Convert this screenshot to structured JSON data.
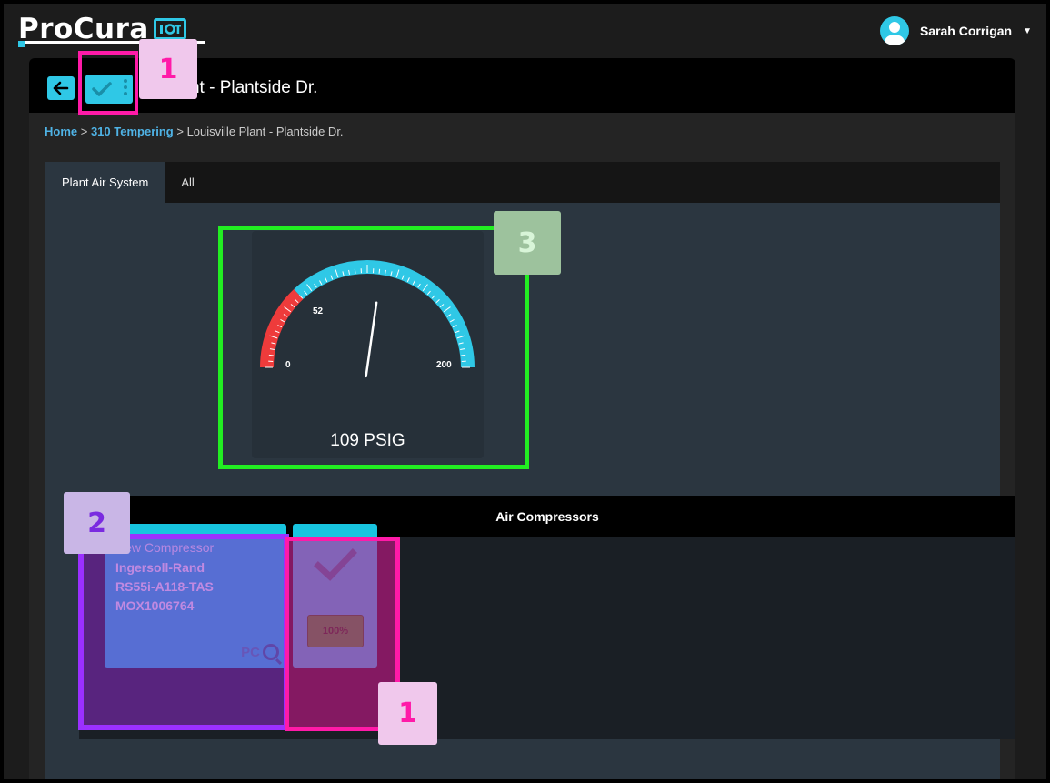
{
  "brand": {
    "name": "ProCura",
    "suffix": "IoT"
  },
  "user": {
    "name": "Sarah Corrigan"
  },
  "page": {
    "title": "ille Plant - Plantside Dr.",
    "breadcrumb": {
      "home": "Home",
      "sep1": " > ",
      "parent": "310 Tempering",
      "sep2": " > ",
      "current": "Louisville Plant - Plantside Dr."
    }
  },
  "tabs": [
    {
      "label": "Plant Air System",
      "active": true
    },
    {
      "label": "All",
      "active": false
    }
  ],
  "gauge": {
    "min_label": "0",
    "max_label": "200",
    "warn_label": "52",
    "min": 0,
    "max": 200,
    "warn": 52,
    "value": 109,
    "display": "109 PSIG",
    "colors": {
      "warn": "#ee3b3b",
      "normal": "#2fc8e6"
    }
  },
  "compressors": {
    "header": "Air Compressors",
    "items": [
      {
        "title": "New Compressor",
        "make": "Ingersoll-Rand",
        "model": "RS55i-A118-TAS",
        "serial": "MOX1006764",
        "badge": "PC",
        "status_percent": "100%"
      }
    ]
  },
  "annotations": {
    "tag1a": "1",
    "tag1b": "1",
    "tag2": "2",
    "tag3": "3",
    "colors": {
      "magenta": "#ff1aa8",
      "purple": "#9b30ff",
      "green": "#22ee22"
    }
  }
}
